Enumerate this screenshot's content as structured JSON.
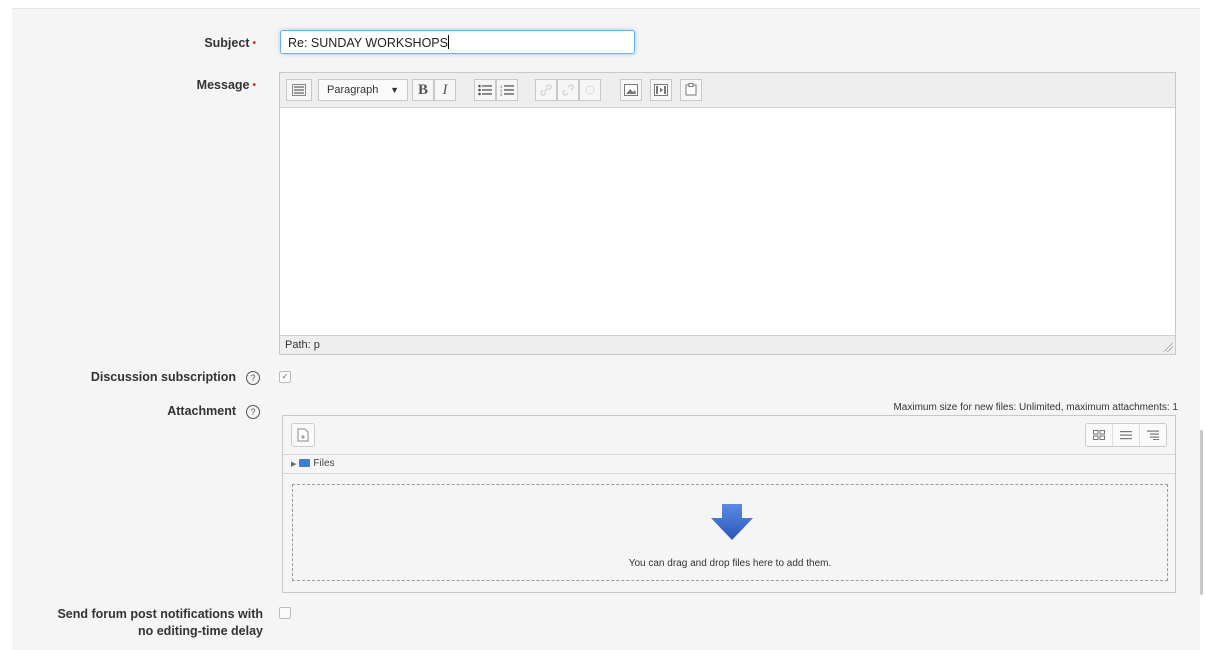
{
  "form": {
    "subject_label": "Subject",
    "subject_value": "Re: SUNDAY WORKSHOPS",
    "message_label": "Message",
    "required_mark": "•",
    "discussion_label": "Discussion subscription",
    "discussion_checked": true,
    "attachment_label": "Attachment",
    "notify_label_line1": "Send forum post notifications with",
    "notify_label_line2": "no editing-time delay",
    "notify_checked": false
  },
  "editor": {
    "paragraph_select": "Paragraph",
    "path_text": "Path: p",
    "toolbar_icons": [
      "toggle-toolbar-icon",
      "bold-icon",
      "italic-icon",
      "unordered-list-icon",
      "ordered-list-icon",
      "link-icon",
      "unlink-icon",
      "anchor-icon",
      "image-icon",
      "media-icon",
      "paste-icon"
    ]
  },
  "filepicker": {
    "max_size_text": "Maximum size for new files: Unlimited, maximum attachments: 1",
    "files_label": "Files",
    "drop_text": "You can drag and drop files here to add them."
  },
  "colors": {
    "required": "#c9302c",
    "focus_border": "#66afe9",
    "drop_arrow": "#3b6fd4"
  }
}
